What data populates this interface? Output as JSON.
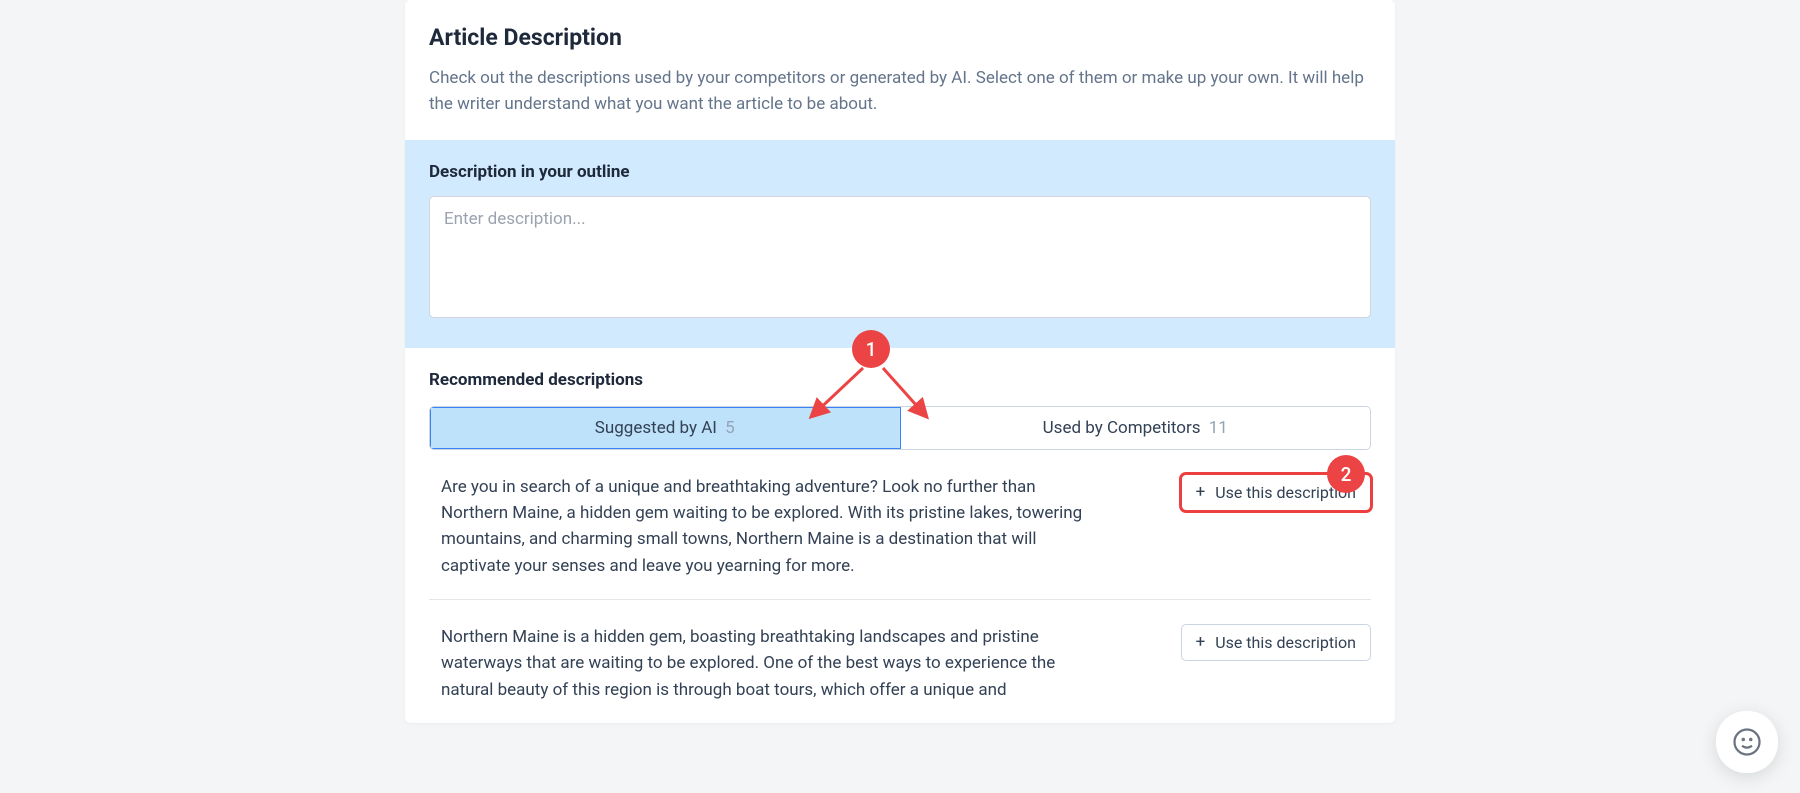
{
  "header": {
    "title": "Article Description",
    "subtitle": "Check out the descriptions used by your competitors or generated by AI. Select one of them or make up your own. It will help the writer understand what you want the article to be about."
  },
  "outline": {
    "label": "Description in your outline",
    "placeholder": "Enter description...",
    "value": ""
  },
  "recommended": {
    "title": "Recommended descriptions",
    "tabs": {
      "ai": {
        "label": "Suggested by AI",
        "count": "5"
      },
      "competitors": {
        "label": "Used by Competitors",
        "count": "11"
      }
    },
    "use_button_label": "Use this description",
    "suggestions": [
      {
        "text": "Are you in search of a unique and breathtaking adventure? Look no further than Northern Maine, a hidden gem waiting to be explored. With its pristine lakes, towering mountains, and charming small towns, Northern Maine is a destination that will captivate your senses and leave you yearning for more."
      },
      {
        "text": "Northern Maine is a hidden gem, boasting breathtaking landscapes and pristine waterways that are waiting to be explored. One of the best ways to experience the natural beauty of this region is through boat tours, which offer a unique and"
      }
    ]
  },
  "annotations": {
    "badge1": "1",
    "badge2": "2"
  }
}
